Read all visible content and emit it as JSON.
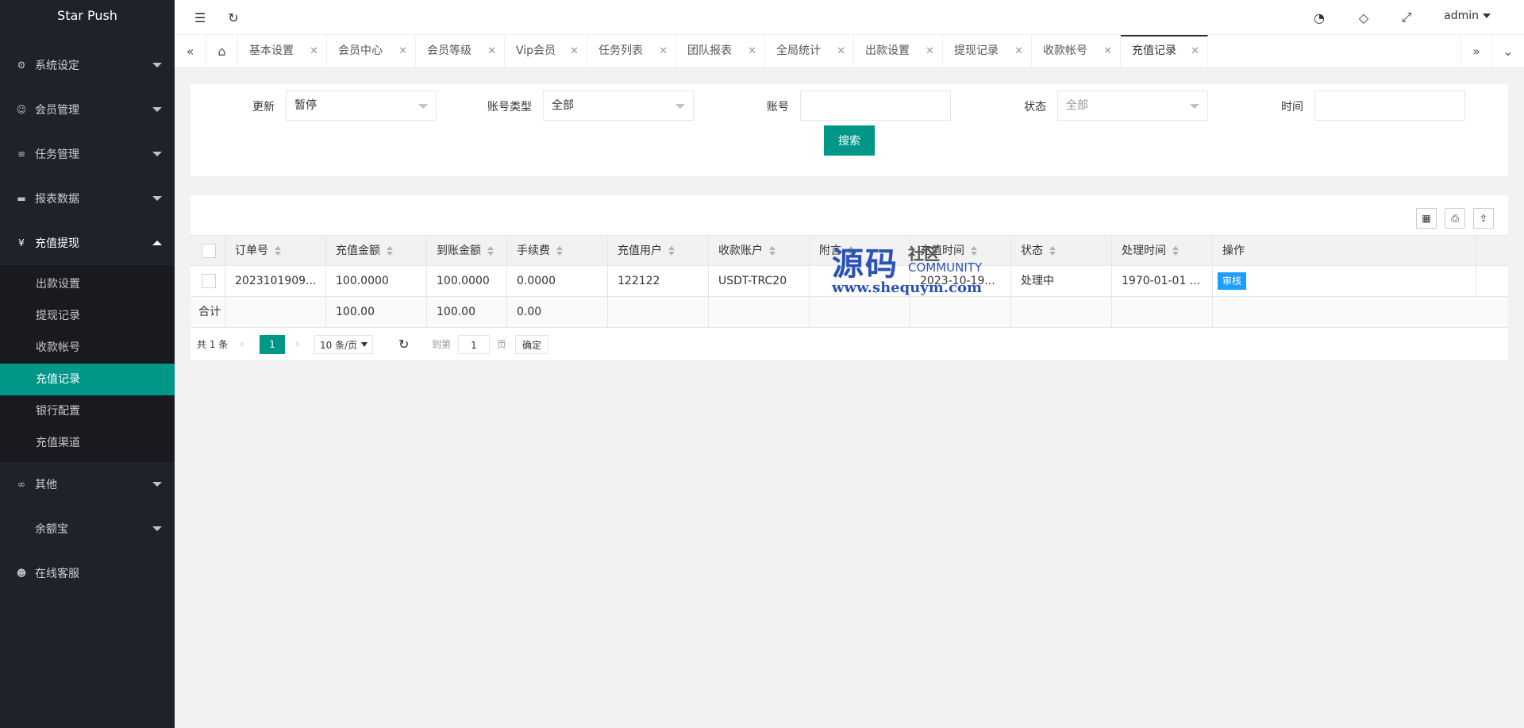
{
  "app": {
    "title": "Star Push"
  },
  "sidebar": {
    "items": [
      {
        "label": "系统设定",
        "icon": "gear-icon"
      },
      {
        "label": "会员管理",
        "icon": "user-icon"
      },
      {
        "label": "任务管理",
        "icon": "list-icon"
      },
      {
        "label": "报表数据",
        "icon": "chart-icon"
      },
      {
        "label": "充值提现",
        "icon": "yen-icon",
        "open": true
      },
      {
        "label": "其他",
        "icon": "link-icon"
      },
      {
        "label": "余额宝",
        "icon": "wallet-icon"
      },
      {
        "label": "在线客服",
        "icon": "service-icon"
      }
    ],
    "submenu": [
      "出款设置",
      "提现记录",
      "收款帐号",
      "充值记录",
      "银行配置",
      "充值渠道"
    ],
    "active_sub": "充值记录"
  },
  "header": {
    "user": "admin"
  },
  "tabs": [
    "基本设置",
    "会员中心",
    "会员等级",
    "Vip会员",
    "任务列表",
    "团队报表",
    "全局统计",
    "出款设置",
    "提现记录",
    "收款帐号",
    "充值记录"
  ],
  "filters": {
    "f1": {
      "label": "更新",
      "value": "暂停"
    },
    "f2": {
      "label": "账号类型",
      "value": "全部"
    },
    "f3": {
      "label": "账号",
      "value": ""
    },
    "f4": {
      "label": "状态",
      "value": "全部"
    },
    "f5": {
      "label": "时间",
      "value": ""
    },
    "search": "搜索"
  },
  "table": {
    "headers": [
      "订单号",
      "充值金额",
      "到账金额",
      "手续费",
      "充值用户",
      "收款账户",
      "附言",
      "充值时间",
      "状态",
      "处理时间",
      "操作"
    ],
    "row": {
      "order": "2023101909...",
      "amount": "100.0000",
      "received": "100.0000",
      "fee": "0.0000",
      "user": "122122",
      "account": "USDT-TRC20",
      "memo": "",
      "time": "2023-10-19...",
      "status": "处理中",
      "processed": "1970-01-01 ...",
      "action": "审核"
    },
    "summary": {
      "label": "合计",
      "amount": "100.00",
      "received": "100.00",
      "fee": "0.00"
    }
  },
  "pager": {
    "total": "共 1 条",
    "current": "1",
    "per_page": "10 条/页",
    "goto": "到第",
    "page_input": "1",
    "page_unit": "页",
    "confirm": "确定"
  },
  "watermark": {
    "big": "源码",
    "top": "社区",
    "word": "COMMUNITY",
    "url": "www.shequym.com"
  }
}
